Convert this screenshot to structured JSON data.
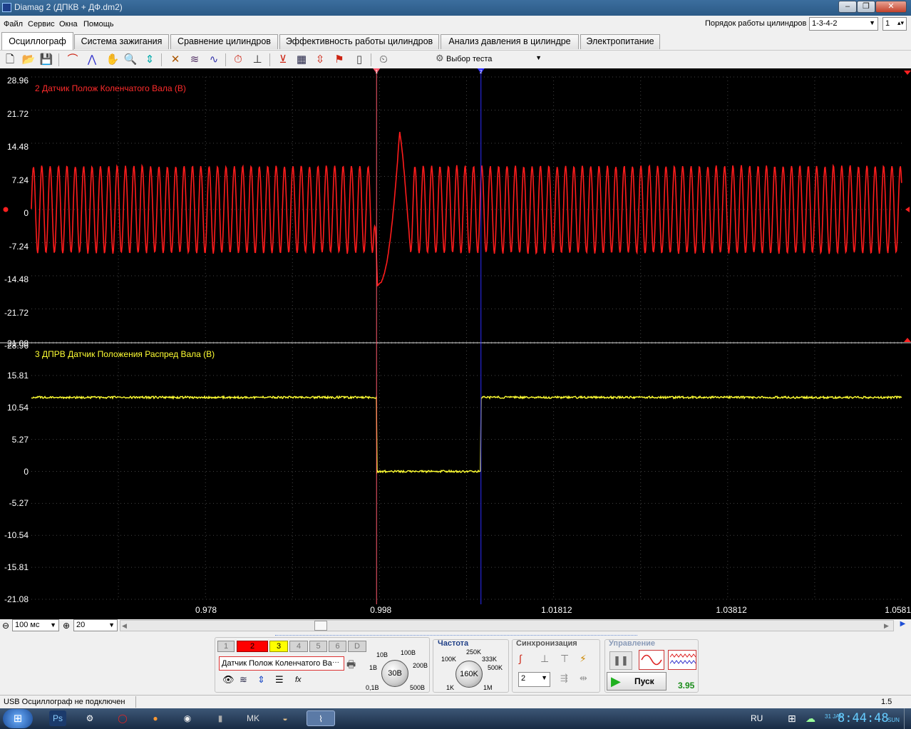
{
  "window": {
    "title": "Diamag 2 (ДПКВ + ДФ.dm2)"
  },
  "menu": [
    "Файл",
    "Сервис",
    "Окна",
    "Помощь"
  ],
  "cylinder_order": {
    "label": "Порядок работы цилиндров",
    "value": "1-3-4-2",
    "spin": "1"
  },
  "tabs": [
    "Осциллограф",
    "Система зажигания",
    "Сравнение цилиндров",
    "Эффективность работы цилиндров",
    "Анализ давления в цилиндре",
    "Электропитание"
  ],
  "toolbar": {
    "test_select": "Выбор теста"
  },
  "chart_data": [
    {
      "type": "line",
      "title": "2 Датчик Полож Коленчатого Вала (В)",
      "color": "#ff1c1c",
      "yticks": [
        "28.96",
        "21.72",
        "14.48",
        "7.24",
        "0",
        "-7.24",
        "-14.48",
        "-21.72",
        "-28.96"
      ],
      "ylim": [
        -28.96,
        28.96
      ],
      "amplitude_approx": 9.5,
      "cycles_visible": 104,
      "gap_event": {
        "x": 0.998,
        "min": -16.5,
        "max": 17.2
      }
    },
    {
      "type": "line",
      "title": "3 ДПРВ Датчик Положения Распред Вала (В)",
      "color": "#ffff33",
      "yticks": [
        "21.08",
        "15.81",
        "10.54",
        "5.27",
        "0",
        "-5.27",
        "-10.54",
        "-15.81",
        "-21.08"
      ],
      "ylim": [
        -21.08,
        21.08
      ],
      "high_level": 12.2,
      "low_level": 0,
      "low_interval": [
        0.998,
        1.00995
      ]
    }
  ],
  "x_axis": {
    "ticks": [
      "0.978",
      "0.998",
      "1.01812",
      "1.03812",
      "1.0581"
    ],
    "xlim": [
      0.9585,
      1.0581
    ]
  },
  "cursors": [
    {
      "label": "1",
      "x": 0.998,
      "color": "#ff5a6e"
    },
    {
      "label": "2",
      "x": 1.00995,
      "color": "#2d2dff"
    }
  ],
  "scale": {
    "time_base": "100 мс",
    "zoom": "20"
  },
  "channels": {
    "buttons": [
      "1",
      "2",
      "3",
      "4",
      "5",
      "6",
      "D"
    ],
    "selected_name": "Датчик Полож Коленчатого Ва"
  },
  "voltage": {
    "scale": [
      "10В",
      "100В",
      "1В",
      "200В",
      "0,1В",
      "500В"
    ],
    "value": "30В"
  },
  "frequency": {
    "title": "Частота",
    "scale": [
      "250K",
      "100K",
      "333K",
      "500K",
      "1K",
      "1M"
    ],
    "value": "160K"
  },
  "sync": {
    "title": "Синхронизация",
    "channel": "2"
  },
  "control": {
    "title": "Управление",
    "start": "Пуск",
    "value": "3.95"
  },
  "status": {
    "text": "USB Осциллограф не подключен",
    "right": "1.5"
  },
  "tray": {
    "lang": "RU",
    "time": "8:44:48",
    "day": "SUN",
    "date": "31 JAN"
  }
}
